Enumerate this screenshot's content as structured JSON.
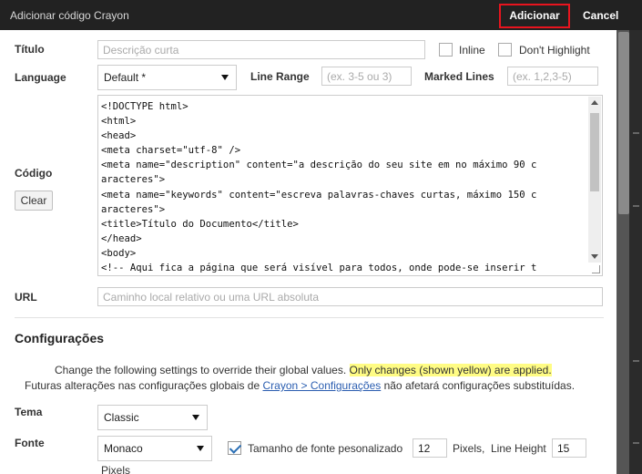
{
  "window": {
    "title": "Adicionar código Crayon",
    "add_label": "Adicionar",
    "cancel_label": "Cancel"
  },
  "form": {
    "title_label": "Título",
    "title_placeholder": "Descrição curta",
    "inline_label": "Inline",
    "dont_highlight_label": "Don't Highlight",
    "language_label": "Language",
    "language_value": "Default *",
    "line_range_label": "Line Range",
    "line_range_placeholder": "(ex. 3-5 ou 3)",
    "marked_lines_label": "Marked Lines",
    "marked_lines_placeholder": "(ex. 1,2,3-5)",
    "code_label": "Código",
    "clear_label": "Clear",
    "code_lines": [
      "<!DOCTYPE html>",
      "<html>",
      "<head>",
      "<meta charset=\"utf-8\" />",
      "<meta name=\"description\" content=\"a descrição do seu site em no máximo 90 c",
      "aracteres\">",
      "<meta name=\"keywords\" content=\"escreva palavras-chaves curtas, máximo 150 c",
      "aracteres\">",
      "<title>Título do Documento</title>",
      "</head>",
      "<body>",
      "<!-- Aqui fica a página que será visível para todos, onde pode-se inserir t"
    ],
    "url_label": "URL",
    "url_placeholder": "Caminho local relativo ou uma URL absoluta"
  },
  "settings": {
    "heading": "Configurações",
    "note1_pre": "Change the following settings to override their global values. ",
    "note1_highlight": "Only changes (shown yellow) are applied.",
    "note2_pre": "Futuras alterações nas configurações globais de ",
    "note2_link": "Crayon > Configurações",
    "note2_post": " não afetará configurações substituídas.",
    "theme_label": "Tema",
    "theme_value": "Classic",
    "font_label": "Fonte",
    "font_value": "Monaco",
    "font_size_label": "Tamanho de fonte pesonalizado",
    "font_size_value": "12",
    "pixels_label_1": "Pixels,",
    "line_height_label": "Line Height",
    "line_height_value": "15",
    "pixels_label_2": "Pixels"
  },
  "colors": {
    "highlight": "#fffc84",
    "add_button_border": "#e8141e",
    "titlebar": "#222222"
  }
}
